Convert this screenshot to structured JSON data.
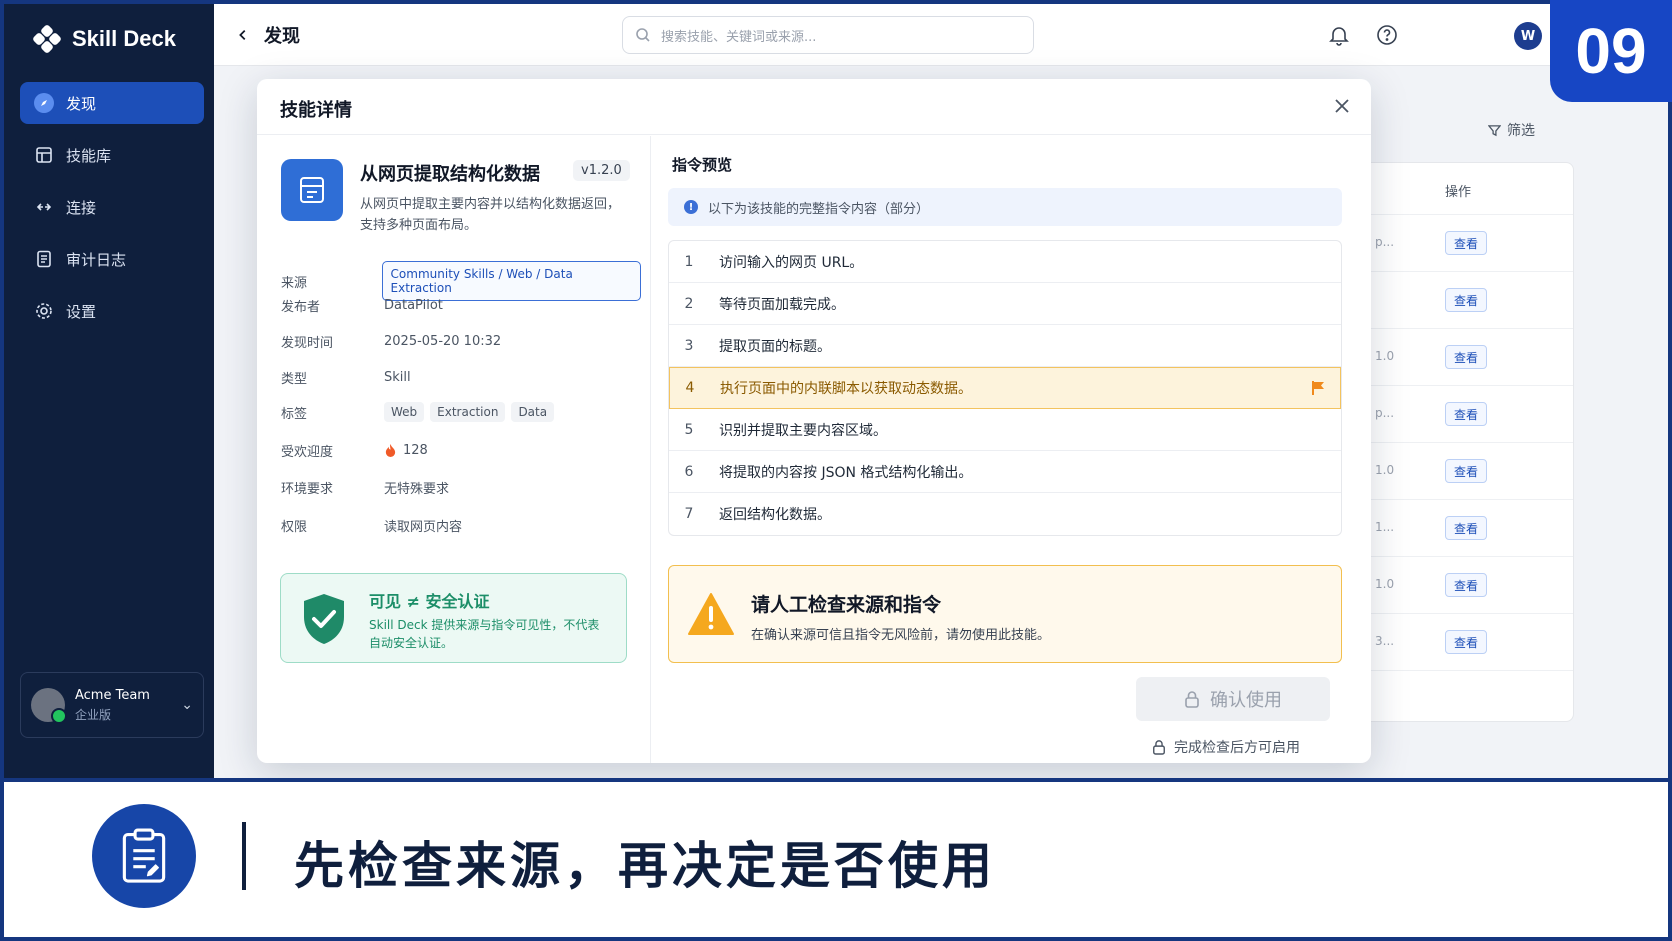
{
  "app": {
    "name": "Skill Deck"
  },
  "sidebar": {
    "items": [
      {
        "label": "发现",
        "icon": "compass-icon",
        "active": true
      },
      {
        "label": "技能库",
        "icon": "library-icon"
      },
      {
        "label": "连接",
        "icon": "connect-icon"
      },
      {
        "label": "审计日志",
        "icon": "audit-log-icon"
      },
      {
        "label": "设置",
        "icon": "gear-icon"
      }
    ],
    "team": {
      "name": "Acme Team",
      "plan": "企业版"
    }
  },
  "header": {
    "title": "发现",
    "search_placeholder": "搜索技能、关键词或来源...",
    "user_initial": "W"
  },
  "background": {
    "filter_label": "筛选",
    "ops_header": "操作",
    "view_label": "查看",
    "row_fragments": [
      "p...",
      "",
      "1.0",
      "p...",
      "1.0",
      "1...",
      "1.0",
      "3..."
    ]
  },
  "modal": {
    "title": "技能详情",
    "skill": {
      "name": "从网页提取结构化数据",
      "version": "v1.2.0",
      "description": "从网页中提取主要内容并以结构化数据返回，支持多种页面布局。"
    },
    "meta": {
      "source_label": "来源",
      "source_value": "Community Skills / Web / Data Extraction",
      "publisher_label": "发布者",
      "publisher_value": "DataPilot",
      "time_label": "发现时间",
      "time_value": "2025-05-20 10:32",
      "type_label": "类型",
      "type_value": "Skill",
      "tags_label": "标签",
      "tags": [
        "Web",
        "Extraction",
        "Data"
      ],
      "popularity_label": "受欢迎度",
      "popularity_value": "128",
      "env_label": "环境要求",
      "env_value": "无特殊要求",
      "perm_label": "权限",
      "perm_value": "读取网页内容"
    },
    "security_notice": {
      "title": "可见 ≠ 安全认证",
      "text": "Skill Deck 提供来源与指令可见性，不代表自动安全认证。"
    },
    "preview": {
      "title": "指令预览",
      "info": "以下为该技能的完整指令内容（部分）",
      "steps": [
        "访问输入的网页 URL。",
        "等待页面加载完成。",
        "提取页面的标题。",
        "执行页面中的内联脚本以获取动态数据。",
        "识别并提取主要内容区域。",
        "将提取的内容按 JSON 格式结构化输出。",
        "返回结构化数据。"
      ],
      "highlighted_step": 4
    },
    "warning": {
      "title": "请人工检查来源和指令",
      "text": "在确认来源可信且指令无风险前，请勿使用此技能。"
    },
    "confirm_label": "确认使用",
    "confirm_hint": "完成检查后方可启用"
  },
  "badge": "09",
  "caption": "先检查来源，再决定是否使用",
  "colors": {
    "primary": "#1d4fb8",
    "sidebar": "#0f1f3d",
    "warning": "#f2bf4f",
    "success": "#1c8e68"
  }
}
